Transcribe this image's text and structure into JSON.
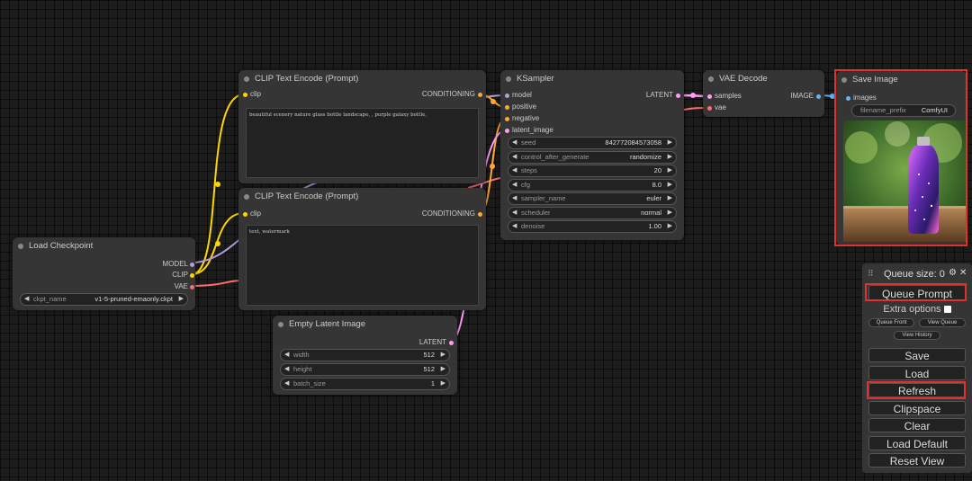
{
  "nodes": {
    "load_checkpoint": {
      "title": "Load Checkpoint",
      "outputs": [
        "MODEL",
        "CLIP",
        "VAE"
      ],
      "ckpt_name": {
        "name": "ckpt_name",
        "value": "v1-5-pruned-emaonly.ckpt"
      }
    },
    "clip_pos": {
      "title": "CLIP Text Encode (Prompt)",
      "input": "clip",
      "output": "CONDITIONING",
      "text": "beautiful scenery nature glass bottle landscape, , purple galaxy bottle,"
    },
    "clip_neg": {
      "title": "CLIP Text Encode (Prompt)",
      "input": "clip",
      "output": "CONDITIONING",
      "text": "text, watermark"
    },
    "empty_latent": {
      "title": "Empty Latent Image",
      "output": "LATENT",
      "widgets": [
        {
          "name": "width",
          "value": "512"
        },
        {
          "name": "height",
          "value": "512"
        },
        {
          "name": "batch_size",
          "value": "1"
        }
      ]
    },
    "ksampler": {
      "title": "KSampler",
      "inputs": [
        "model",
        "positive",
        "negative",
        "latent_image"
      ],
      "output": "LATENT",
      "widgets": [
        {
          "name": "seed",
          "value": "842772084573058"
        },
        {
          "name": "control_after_generate",
          "value": "randomize"
        },
        {
          "name": "steps",
          "value": "20"
        },
        {
          "name": "cfg",
          "value": "8.0"
        },
        {
          "name": "sampler_name",
          "value": "euler"
        },
        {
          "name": "scheduler",
          "value": "normal"
        },
        {
          "name": "denoise",
          "value": "1.00"
        }
      ]
    },
    "vae_decode": {
      "title": "VAE Decode",
      "inputs": [
        "samples",
        "vae"
      ],
      "output": "IMAGE"
    },
    "save_image": {
      "title": "Save Image",
      "input": "images",
      "filename_prefix": {
        "name": "filename_prefix",
        "value": "ComfyUI"
      }
    }
  },
  "menu": {
    "queue_size": "Queue size: 0",
    "queue_prompt": "Queue Prompt",
    "extra_options": "Extra options",
    "queue_front": "Queue Front",
    "view_queue": "View Queue",
    "view_history": "View History",
    "buttons": [
      "Save",
      "Load",
      "Refresh",
      "Clipspace",
      "Clear",
      "Load Default",
      "Reset View"
    ]
  },
  "colors": {
    "clip": "#ffd500",
    "model": "#b39ddb",
    "vae": "#ff6e6e",
    "conditioning": "#ffa931",
    "latent": "#ff9cf9",
    "image": "#64b5f6",
    "highlight": "#e03030"
  },
  "icons": {
    "gear": "gear-icon",
    "close": "close-icon",
    "drag": "drag-handle-icon"
  }
}
